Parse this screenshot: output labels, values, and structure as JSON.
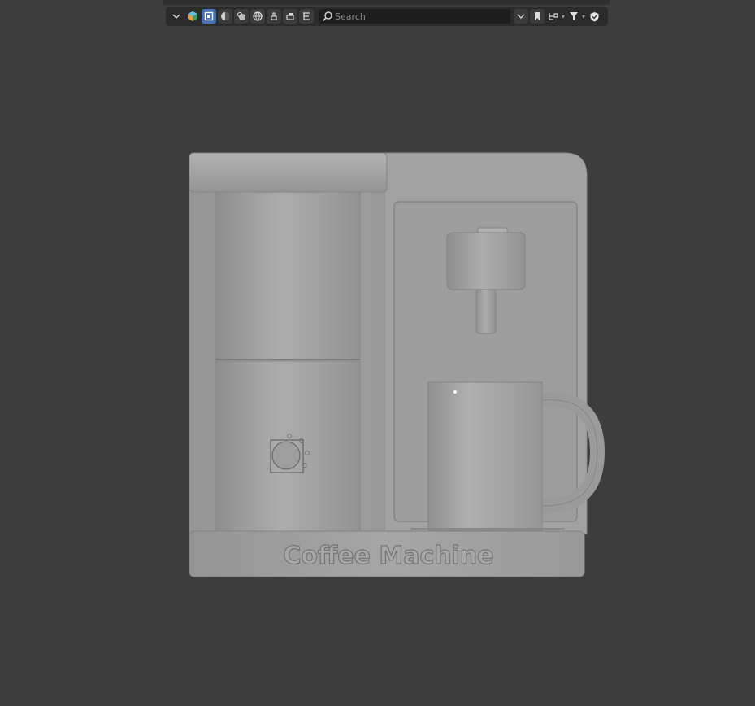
{
  "outliner_toolbar": {
    "search": {
      "placeholder": "Search",
      "value": ""
    },
    "icons": {
      "collapse": "chevron-down-icon",
      "scene": "scene-icon",
      "select_box": "select-box-icon",
      "shading_solid": "sphere-icon",
      "shading_material": "material-icon",
      "world": "world-icon",
      "filter_a": "restrict-select-icon",
      "filter_b": "print-icon",
      "filter_c": "hierarchy-icon",
      "view_mode": "view-mode-icon",
      "bookmark": "bookmark-icon",
      "sync": "sync-icon",
      "filter": "filter-icon",
      "shield": "shield-icon"
    }
  },
  "viewport": {
    "background": "#3d3d3d",
    "model_label": "Coffee Machine",
    "model_color": "#a3a3a3"
  }
}
